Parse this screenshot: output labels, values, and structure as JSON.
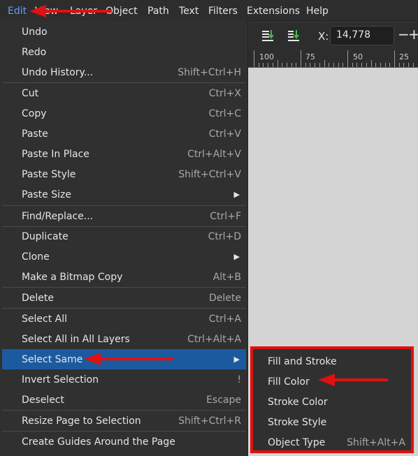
{
  "menubar": {
    "items": [
      "Edit",
      "View",
      "Layer",
      "Object",
      "Path",
      "Text",
      "Filters",
      "Extensions",
      "Help"
    ]
  },
  "toolbar": {
    "x_label": "X:",
    "x_value": "14,778",
    "minus": "−",
    "plus": "+"
  },
  "ruler": {
    "labels": [
      "100",
      "75",
      "50",
      "25"
    ]
  },
  "edit_menu": {
    "items": [
      {
        "label": "Undo",
        "shortcut": ""
      },
      {
        "label": "Redo",
        "shortcut": ""
      },
      {
        "label": "Undo History...",
        "shortcut": "Shift+Ctrl+H"
      },
      {
        "label": "Cut",
        "shortcut": "Ctrl+X"
      },
      {
        "label": "Copy",
        "shortcut": "Ctrl+C"
      },
      {
        "label": "Paste",
        "shortcut": "Ctrl+V"
      },
      {
        "label": "Paste In Place",
        "shortcut": "Ctrl+Alt+V"
      },
      {
        "label": "Paste Style",
        "shortcut": "Shift+Ctrl+V"
      },
      {
        "label": "Paste Size",
        "shortcut": ""
      },
      {
        "label": "Find/Replace...",
        "shortcut": "Ctrl+F"
      },
      {
        "label": "Duplicate",
        "shortcut": "Ctrl+D"
      },
      {
        "label": "Clone",
        "shortcut": ""
      },
      {
        "label": "Make a Bitmap Copy",
        "shortcut": "Alt+B"
      },
      {
        "label": "Delete",
        "shortcut": "Delete"
      },
      {
        "label": "Select All",
        "shortcut": "Ctrl+A"
      },
      {
        "label": "Select All in All Layers",
        "shortcut": "Ctrl+Alt+A"
      },
      {
        "label": "Select Same",
        "shortcut": ""
      },
      {
        "label": "Invert Selection",
        "shortcut": "!"
      },
      {
        "label": "Deselect",
        "shortcut": "Escape"
      },
      {
        "label": "Resize Page to Selection",
        "shortcut": "Shift+Ctrl+R"
      },
      {
        "label": "Create Guides Around the Page",
        "shortcut": ""
      }
    ]
  },
  "select_same_submenu": {
    "items": [
      {
        "label": "Fill and Stroke",
        "shortcut": ""
      },
      {
        "label": "Fill Color",
        "shortcut": ""
      },
      {
        "label": "Stroke Color",
        "shortcut": ""
      },
      {
        "label": "Stroke Style",
        "shortcut": ""
      },
      {
        "label": "Object Type",
        "shortcut": "Shift+Alt+A"
      }
    ]
  },
  "colors": {
    "highlight": "#1c5aa0",
    "annotation": "#e01010",
    "active_menu": "#5aa0ff"
  }
}
